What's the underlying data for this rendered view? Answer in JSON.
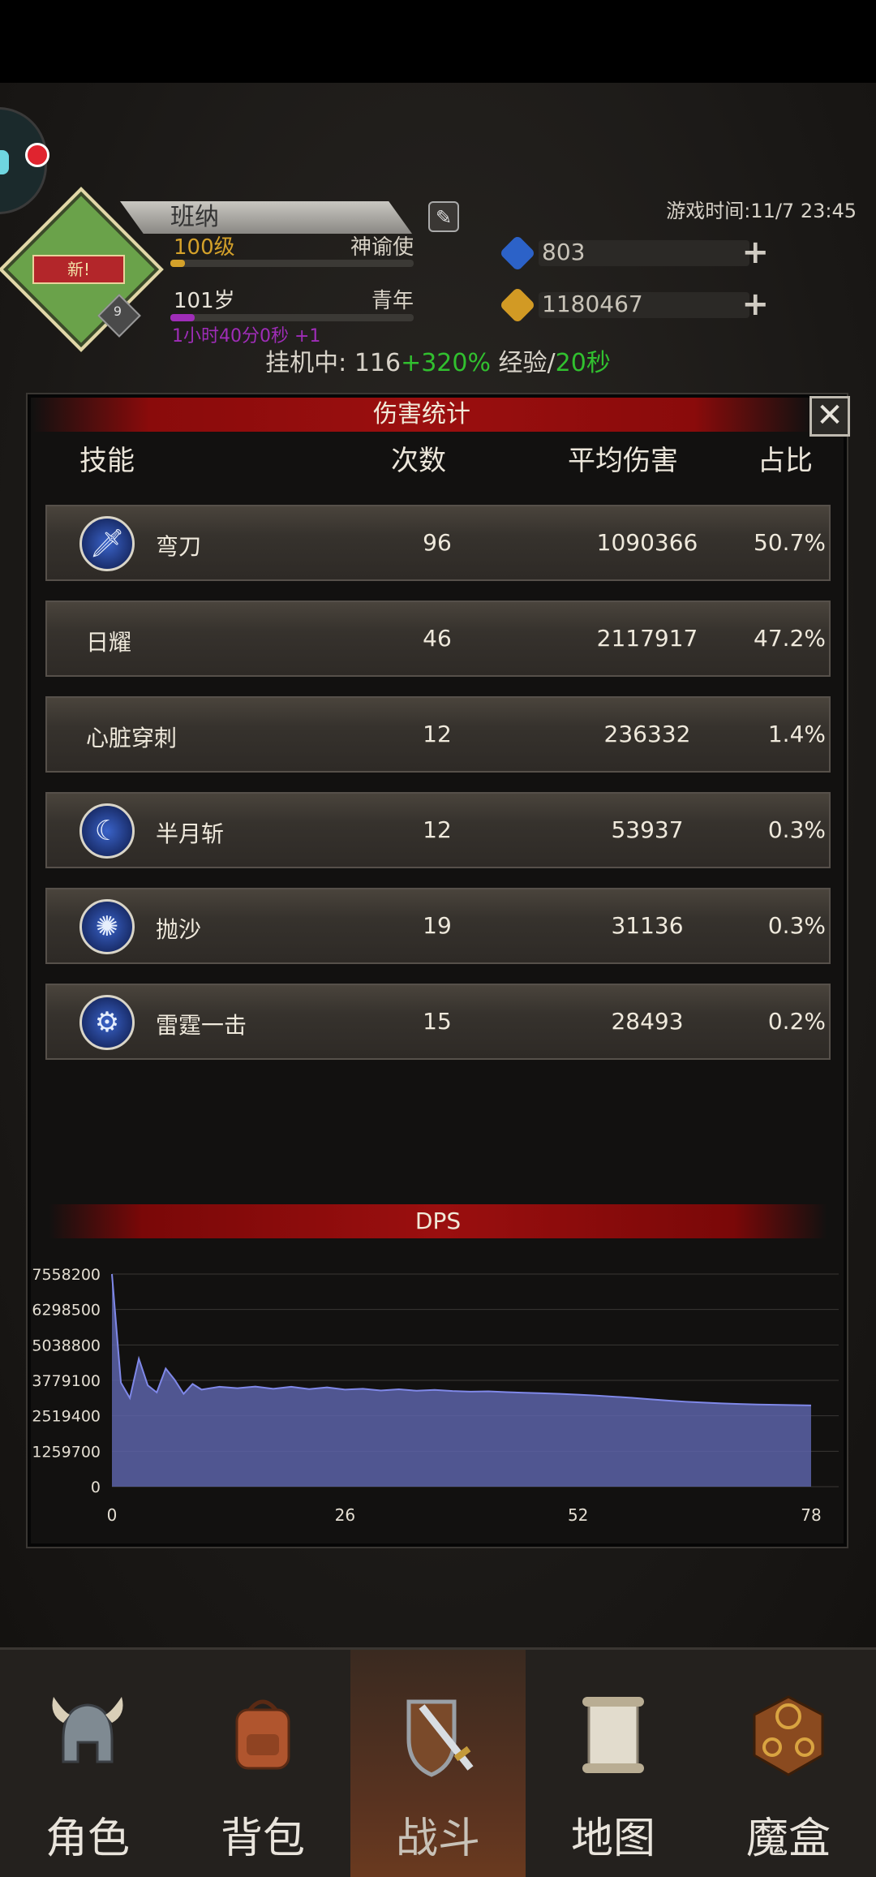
{
  "header": {
    "player_name": "班纳",
    "level": "100级",
    "title": "神谕使",
    "age": "101岁",
    "age_stage": "青年",
    "offline_timer": "1小时40分0秒 +1",
    "emblem_label": "新!",
    "emblem_badge": "9",
    "game_time": "游戏时间:11/7 23:45",
    "resources": [
      {
        "icon": "blue-gem-icon",
        "value": "803"
      },
      {
        "icon": "gold-coin-icon",
        "value": "1180467"
      }
    ],
    "idle": {
      "prefix": "挂机中:",
      "base": "116",
      "bonus": "+320%",
      "exp": "经验/",
      "interval": "20秒"
    }
  },
  "panel": {
    "title": "伤害统计",
    "columns": {
      "skill": "技能",
      "count": "次数",
      "avg": "平均伤害",
      "ratio": "占比"
    },
    "rows": [
      {
        "name": "弯刀",
        "icon": "sword-icon",
        "count": "96",
        "avg": "1090366",
        "ratio": "50.7%"
      },
      {
        "name": "日耀",
        "icon": "",
        "count": "46",
        "avg": "2117917",
        "ratio": "47.2%"
      },
      {
        "name": "心脏穿刺",
        "icon": "",
        "count": "12",
        "avg": "236332",
        "ratio": "1.4%"
      },
      {
        "name": "半月斩",
        "icon": "crescent-moon-icon",
        "count": "12",
        "avg": "53937",
        "ratio": "0.3%"
      },
      {
        "name": "抛沙",
        "icon": "sand-splash-icon",
        "count": "19",
        "avg": "31136",
        "ratio": "0.3%"
      },
      {
        "name": "雷霆一击",
        "icon": "thunder-orb-icon",
        "count": "15",
        "avg": "28493",
        "ratio": "0.2%"
      }
    ]
  },
  "chart_data": {
    "type": "area",
    "title": "DPS",
    "xlabel": "",
    "ylabel": "",
    "xlim": [
      0,
      78
    ],
    "ylim": [
      0,
      7558200
    ],
    "xticks": [
      "0",
      "26",
      "52",
      "78"
    ],
    "yticks": [
      "7558200",
      "6298500",
      "5038800",
      "3779100",
      "2519400",
      "1259700",
      "0"
    ],
    "grid": true,
    "color": "#5c63a8",
    "x": [
      0,
      1,
      2,
      3,
      4,
      5,
      6,
      7,
      8,
      9,
      10,
      12,
      14,
      16,
      18,
      20,
      22,
      24,
      26,
      28,
      30,
      32,
      34,
      36,
      38,
      40,
      42,
      44,
      46,
      48,
      50,
      52,
      54,
      56,
      58,
      60,
      62,
      64,
      66,
      68,
      70,
      72,
      74,
      76,
      78
    ],
    "values": [
      7558200,
      3700000,
      3150000,
      4550000,
      3600000,
      3350000,
      4200000,
      3800000,
      3300000,
      3650000,
      3450000,
      3550000,
      3500000,
      3560000,
      3480000,
      3550000,
      3470000,
      3530000,
      3450000,
      3480000,
      3420000,
      3460000,
      3410000,
      3440000,
      3400000,
      3380000,
      3390000,
      3360000,
      3340000,
      3320000,
      3300000,
      3270000,
      3240000,
      3200000,
      3160000,
      3110000,
      3060000,
      3020000,
      2990000,
      2960000,
      2940000,
      2920000,
      2910000,
      2900000,
      2890000
    ]
  },
  "nav": {
    "items": [
      {
        "label": "角色",
        "icon": "helmet-icon"
      },
      {
        "label": "背包",
        "icon": "backpack-icon"
      },
      {
        "label": "战斗",
        "icon": "sword-shield-icon",
        "active": true
      },
      {
        "label": "地图",
        "icon": "scroll-map-icon"
      },
      {
        "label": "魔盒",
        "icon": "magic-box-icon"
      }
    ]
  }
}
